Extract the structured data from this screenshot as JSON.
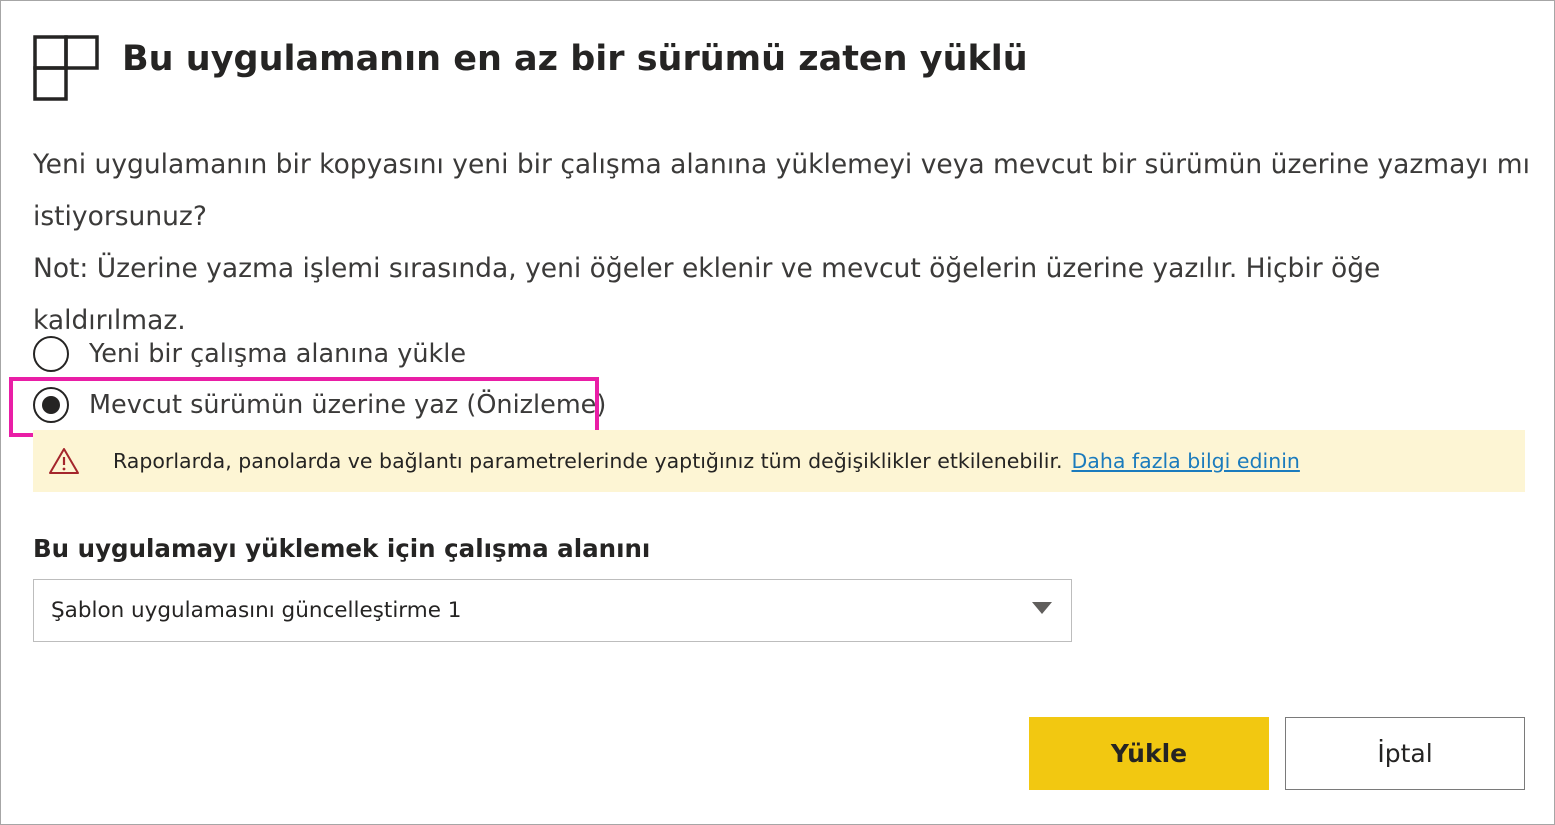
{
  "dialog": {
    "icon": "app-grid-icon",
    "title": "Bu uygulamanın en az bir sürümü zaten yüklü",
    "description_line1": "Yeni uygulamanın bir kopyasını yeni bir çalışma alanına yüklemeyi veya mevcut bir sürümün üzerine yazmayı mı istiyorsunuz?",
    "description_line2": "Not: Üzerine yazma işlemi sırasında, yeni öğeler eklenir ve mevcut öğelerin üzerine yazılır. Hiçbir öğe kaldırılmaz."
  },
  "options": [
    {
      "label": "Yeni bir çalışma alanına yükle",
      "selected": false
    },
    {
      "label": "Mevcut sürümün üzerine yaz (Önizleme)",
      "selected": true
    }
  ],
  "highlight_color": "#e91ea6",
  "warning": {
    "icon": "warning-triangle-icon",
    "text": "Raporlarda, panolarda ve bağlantı parametrelerinde yaptığınız tüm değişiklikler etkilenebilir.",
    "link": "Daha fazla bilgi edinin",
    "background": "#fdf5d4"
  },
  "workspace": {
    "label": "Bu uygulamayı yüklemek için çalışma alanını",
    "selected_value": "Şablon uygulamasını güncelleştirme 1"
  },
  "buttons": {
    "install": "Yükle",
    "cancel": "İptal",
    "accent": "#f2c811"
  }
}
